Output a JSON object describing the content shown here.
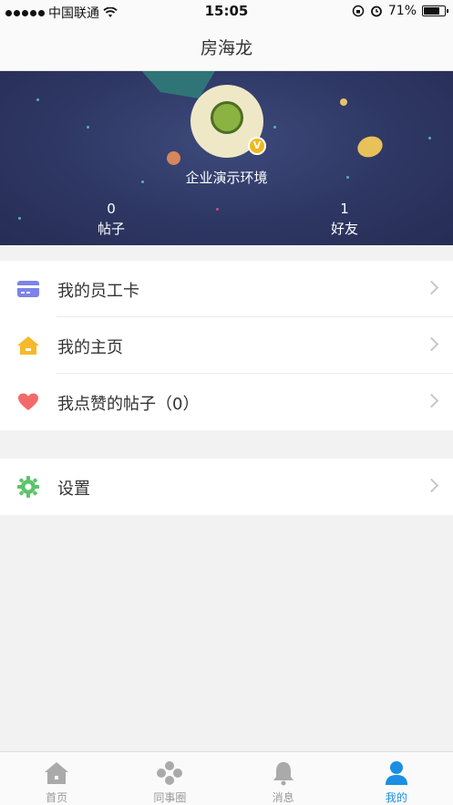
{
  "status_bar": {
    "carrier": "中国联通",
    "time": "15:05",
    "battery": "71%",
    "battery_level": 0.71
  },
  "nav": {
    "title": "房海龙"
  },
  "profile": {
    "company": "企业演示环境",
    "badge": "V",
    "stats": [
      {
        "value": "0",
        "label": "帖子"
      },
      {
        "value": "1",
        "label": "好友"
      }
    ]
  },
  "menu": {
    "items": [
      {
        "label": "我的员工卡",
        "icon": "card-icon",
        "color": "#7c83e8"
      },
      {
        "label": "我的主页",
        "icon": "home-icon",
        "color": "#f6b92b"
      },
      {
        "label": "我点赞的帖子（0）",
        "icon": "heart-icon",
        "color": "#f46a6a"
      }
    ],
    "settings": {
      "label": "设置",
      "icon": "gear-icon",
      "color": "#5cc46a"
    }
  },
  "tabs": [
    {
      "label": "首页",
      "icon": "home-tab-icon",
      "active": false
    },
    {
      "label": "同事圈",
      "icon": "circle-tab-icon",
      "active": false
    },
    {
      "label": "消息",
      "icon": "bell-tab-icon",
      "active": false
    },
    {
      "label": "我的",
      "icon": "user-tab-icon",
      "active": true
    }
  ],
  "colors": {
    "accent": "#1a8fe3",
    "tab_inactive": "#999999"
  }
}
